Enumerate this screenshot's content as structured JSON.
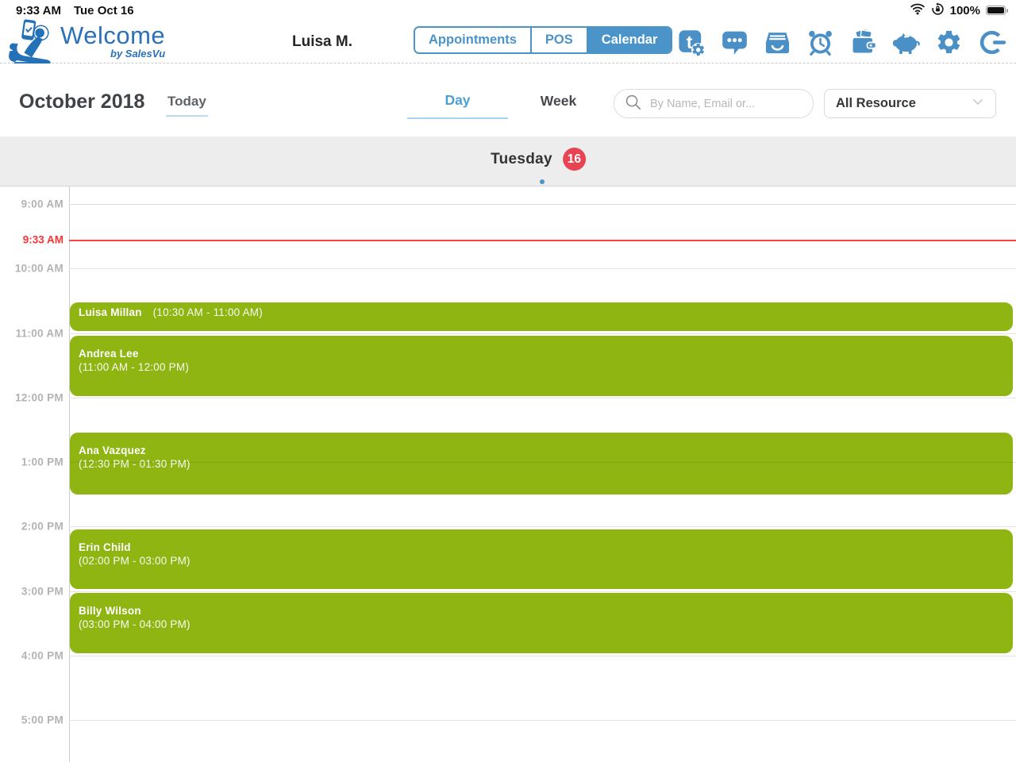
{
  "status_bar": {
    "time": "9:33 AM",
    "date": "Tue Oct 16",
    "battery_percent": "100%"
  },
  "header": {
    "logo": {
      "title": "Welcome",
      "subtitle": "by SalesVu"
    },
    "user_name": "Luisa M.",
    "tabs": [
      {
        "label": "Appointments",
        "active": false
      },
      {
        "label": "POS",
        "active": false
      },
      {
        "label": "Calendar",
        "active": true
      }
    ],
    "icons": [
      "text-gear",
      "messages",
      "archive-tray",
      "alarm-clock",
      "wallet",
      "piggy-bank",
      "settings-gear",
      "logout"
    ]
  },
  "toolbar": {
    "month_title": "October 2018",
    "today_label": "Today",
    "view_tabs": [
      {
        "label": "Day",
        "active": true
      },
      {
        "label": "Week",
        "active": false
      }
    ],
    "search_placeholder": "By Name, Email or...",
    "resource_filter_value": "All Resource"
  },
  "day_header": {
    "weekday": "Tuesday",
    "day_number": "16"
  },
  "calendar": {
    "current_time_label": "9:33 AM",
    "hours": [
      "9:00 AM",
      "10:00 AM",
      "11:00 AM",
      "12:00 PM",
      "1:00 PM",
      "2:00 PM",
      "3:00 PM",
      "4:00 PM",
      "5:00 PM"
    ],
    "appointments": [
      {
        "name": "Luisa Millan",
        "time": "(10:30 AM - 11:00 AM)"
      },
      {
        "name": "Andrea Lee",
        "time": "(11:00 AM - 12:00 PM)"
      },
      {
        "name": "Ana Vazquez",
        "time": "(12:30 PM - 01:30 PM)"
      },
      {
        "name": "Erin Child",
        "time": "(02:00 PM - 03:00 PM)"
      },
      {
        "name": "Billy Wilson",
        "time": "(03:00 PM - 04:00 PM)"
      }
    ]
  },
  "colors": {
    "accent_blue": "#4a94ca",
    "logo_blue": "#2a70ba",
    "event_green": "#8eb511",
    "current_time_red": "#fb4545",
    "badge_red": "#e84353",
    "day_header_bg": "#ededee"
  }
}
